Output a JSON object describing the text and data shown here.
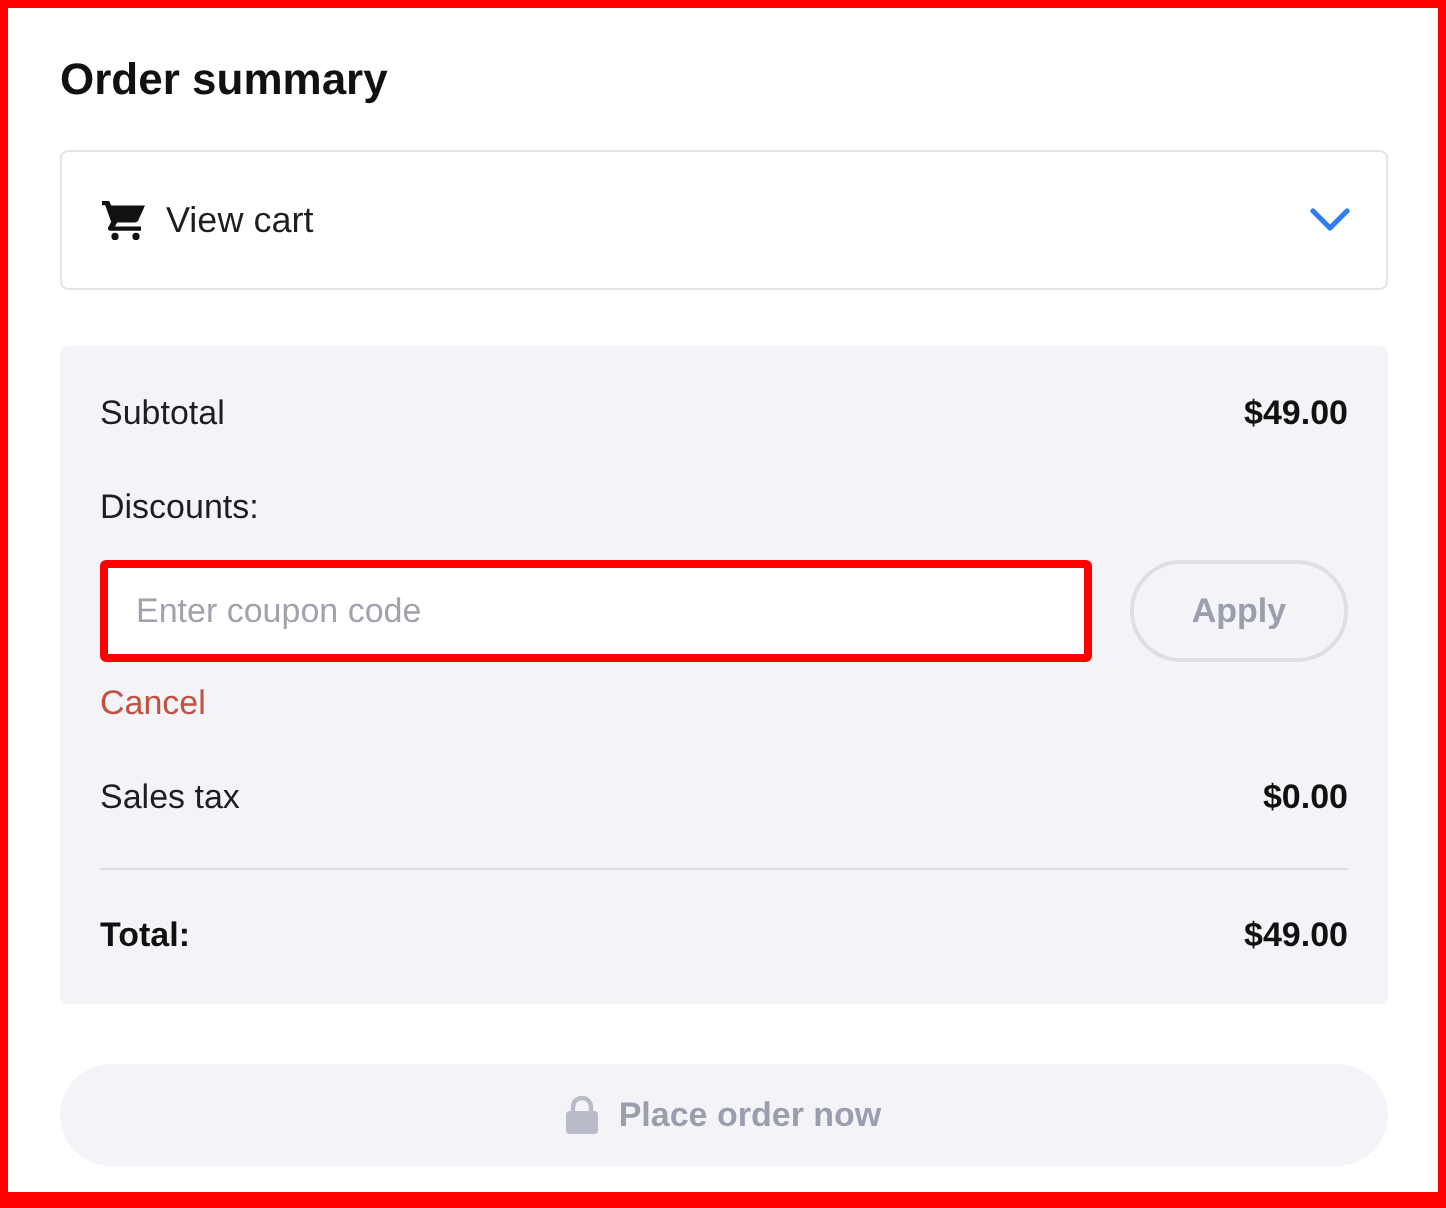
{
  "title": "Order summary",
  "cart_toggle": {
    "label": "View cart",
    "expanded": false
  },
  "summary": [
    {
      "kind": "amount",
      "label": "Subtotal",
      "value": "$49.00"
    },
    {
      "kind": "coupon",
      "label": "Discounts:",
      "placeholder": "Enter coupon code",
      "highlighted": true,
      "apply": {
        "label": "Apply",
        "disabled": true
      },
      "cancel": "Cancel"
    },
    {
      "kind": "amount",
      "label": "Sales tax",
      "value": "$0.00"
    },
    {
      "kind": "total",
      "label": "Total:",
      "value": "$49.00"
    }
  ],
  "place_order": {
    "label": "Place order now",
    "disabled": true
  }
}
